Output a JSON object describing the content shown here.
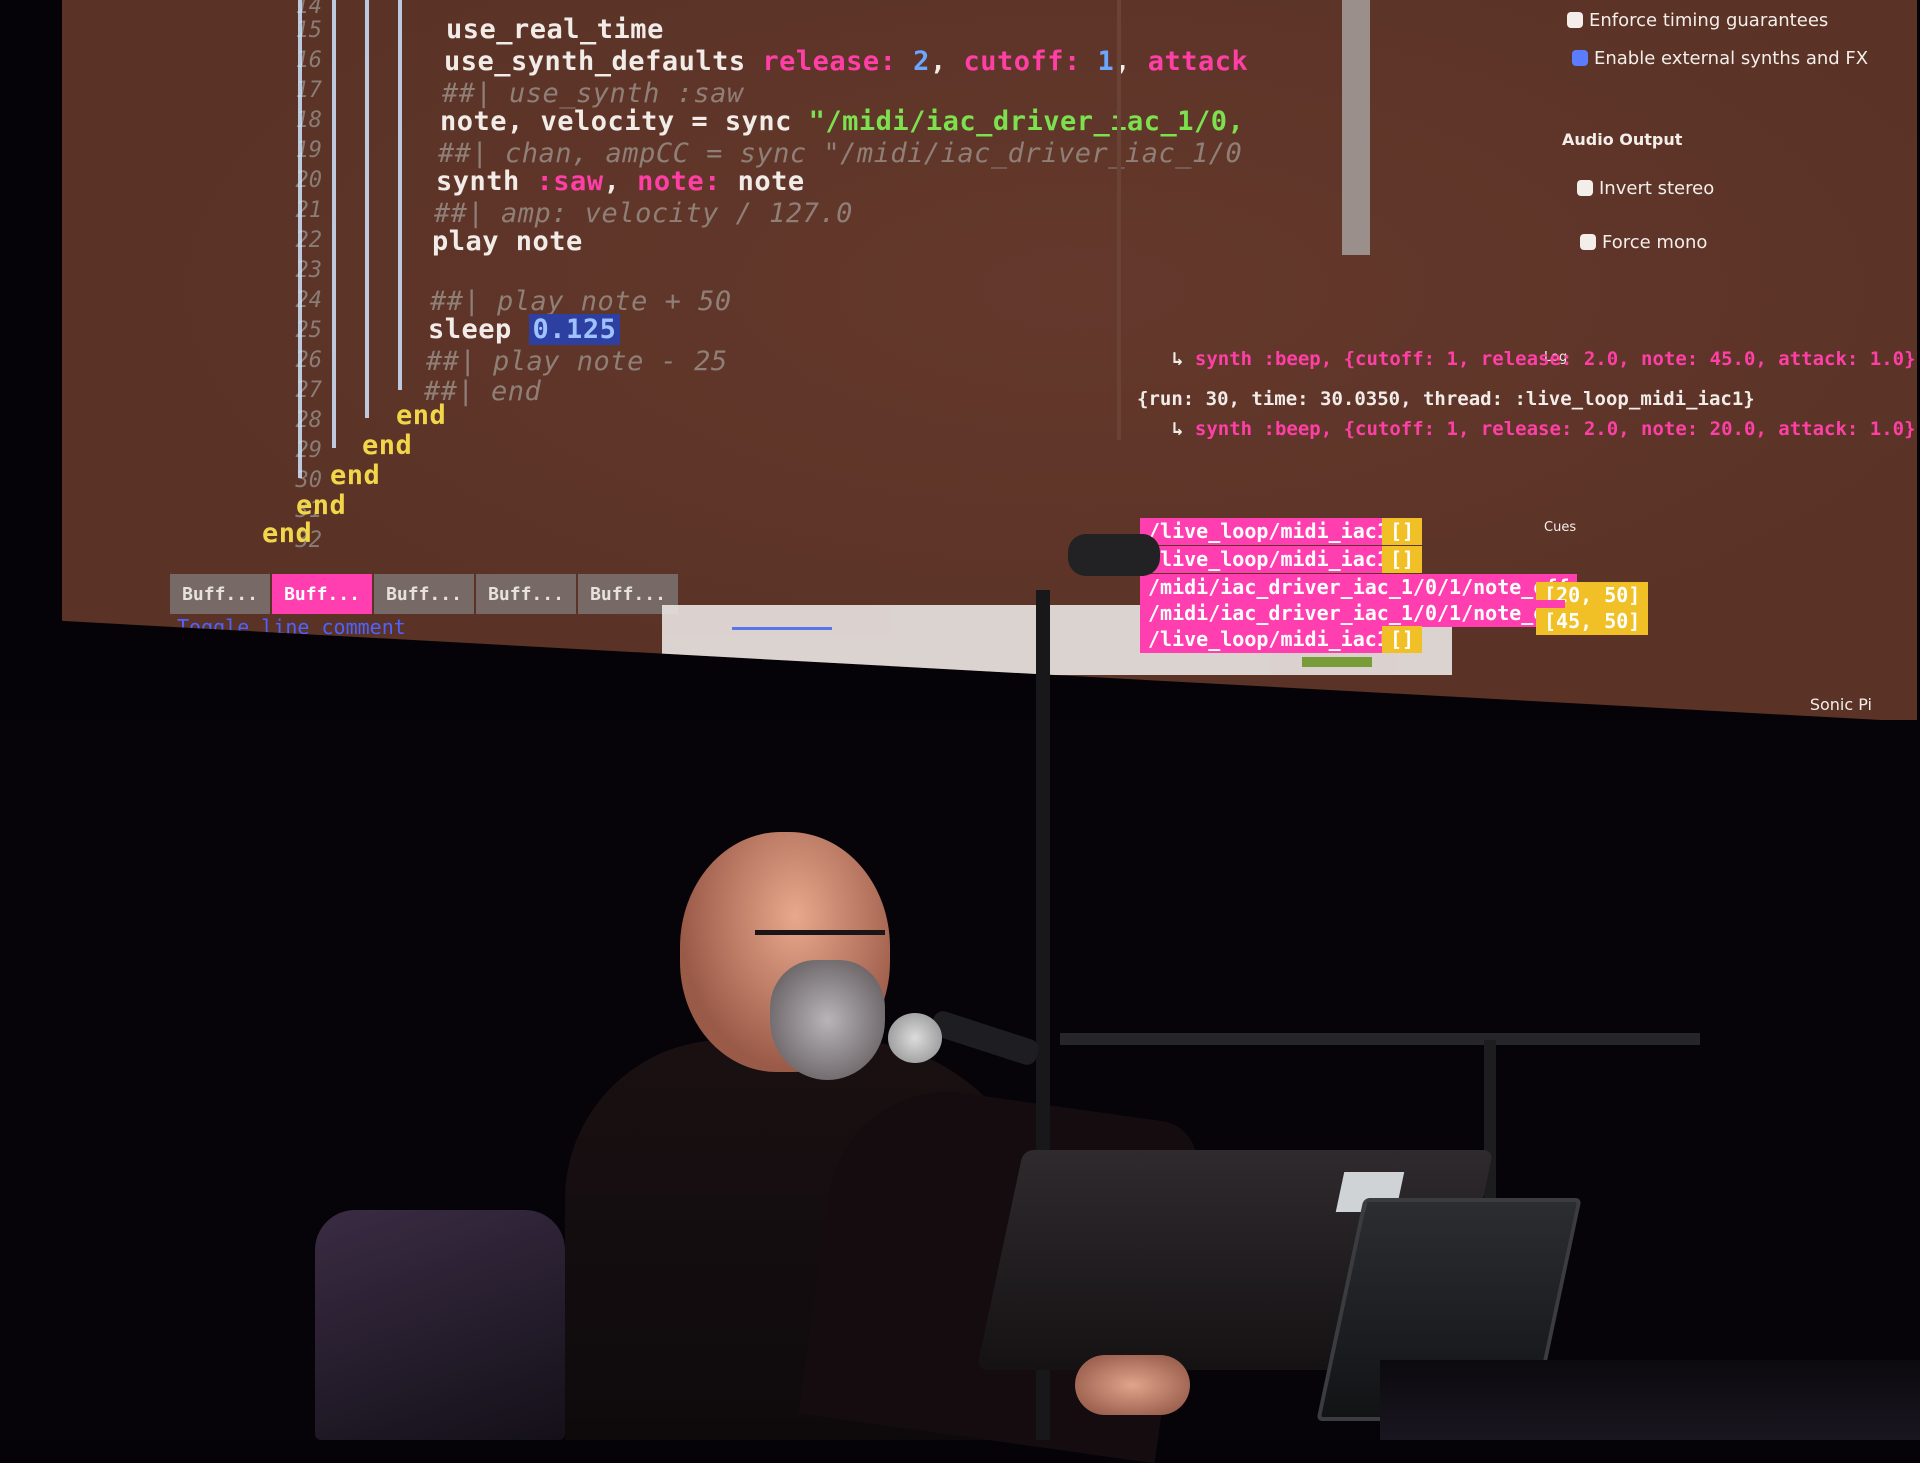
{
  "editor": {
    "line_numbers": [
      "14",
      "15",
      "16",
      "17",
      "18",
      "19",
      "20",
      "21",
      "22",
      "23",
      "24",
      "25",
      "26",
      "27",
      "28",
      "29",
      "30",
      "31",
      "32"
    ],
    "lines": {
      "l15": "use_real_time",
      "l16_a": "use_synth_defaults ",
      "l16_b": "release: ",
      "l16_c": "2",
      "l16_d": ", ",
      "l16_e": "cutoff: ",
      "l16_f": "1",
      "l16_g": ", ",
      "l16_h": "attack",
      "l17": "##| use_synth :saw",
      "l18_a": "note, velocity = sync ",
      "l18_b": "\"/midi/iac_driver_iac_1/0,",
      "l19": "##| chan, ampCC = sync \"/midi/iac_driver_iac_1/0",
      "l20_a": "synth ",
      "l20_b": ":saw",
      "l20_c": ", ",
      "l20_d": "note:",
      "l20_e": " note",
      "l21": "##| amp: velocity / 127.0",
      "l22": "play note",
      "l24": "##| play note + 50",
      "l25_a": "sleep ",
      "l25_b": "0.125",
      "l26": "##| play note - 25",
      "l27": "##| end",
      "end": "end"
    },
    "tabs": [
      "Buff...",
      "Buff...",
      "Buff...",
      "Buff...",
      "Buff..."
    ],
    "active_tab": 1,
    "status": "Toggle line comment"
  },
  "prefs": {
    "timing": "Enforce timing guarantees",
    "external": "Enable external synths and FX",
    "audio_output_heading": "Audio Output",
    "invert": "Invert stereo",
    "mono": "Force mono"
  },
  "log": {
    "label": "Log",
    "line1": "synth :beep, {cutoff: 1, release: 2.0, note: 45.0, attack: 1.0}",
    "line2": "{run: 30, time: 30.0350, thread: :live_loop_midi_iac1}",
    "line3": "synth :beep, {cutoff: 1, release: 2.0, note: 20.0, attack: 1.0}"
  },
  "cues": {
    "label": "Cues",
    "items": [
      {
        "path": "/live_loop/midi_iac1",
        "value": "[]"
      },
      {
        "path": "/live_loop/midi_iac1",
        "value": "[]"
      },
      {
        "path": "/midi/iac_driver_iac_1/0/1/note_off",
        "value": "[20, 50]"
      },
      {
        "path": "/midi/iac_driver_iac_1/0/1/note_on",
        "value": "[45, 50]"
      },
      {
        "path": "/live_loop/midi_iac1",
        "value": "[]"
      }
    ]
  },
  "app_name": "Sonic Pi",
  "colors": {
    "background": "#5a3226",
    "keyword_pink": "#ff3fa6",
    "string_green": "#7de04f",
    "end_yellow": "#f2d64a",
    "number_blue": "#6aa7ff"
  }
}
